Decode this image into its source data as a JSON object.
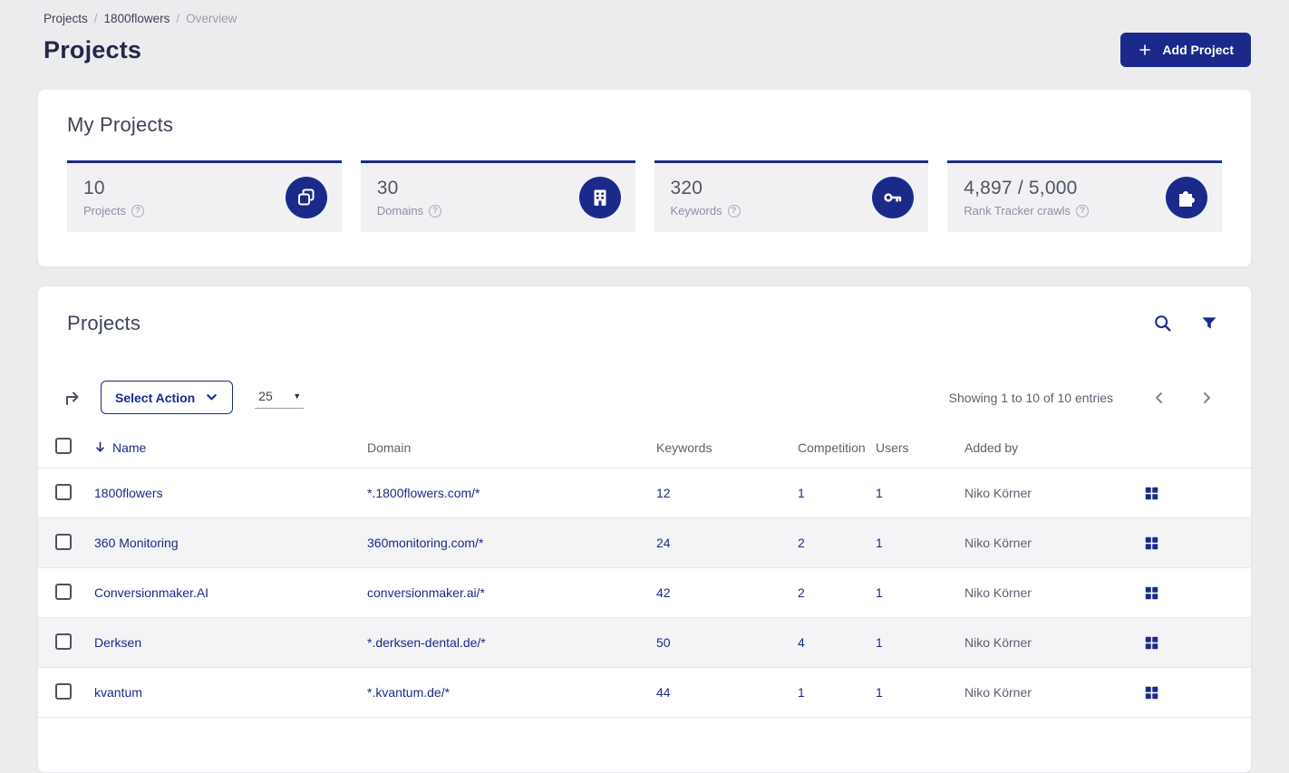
{
  "colors": {
    "primary": "#1b2a8a"
  },
  "breadcrumb": {
    "separator": "/",
    "items": [
      {
        "label": "Projects"
      },
      {
        "label": "1800flowers"
      },
      {
        "label": "Overview"
      }
    ]
  },
  "page": {
    "title": "Projects",
    "add_project_button": "Add Project"
  },
  "my_projects": {
    "title": "My Projects",
    "tiles": [
      {
        "value": "10",
        "label": "Projects",
        "icon": "copy-icon"
      },
      {
        "value": "30",
        "label": "Domains",
        "icon": "building-icon"
      },
      {
        "value": "320",
        "label": "Keywords",
        "icon": "key-icon"
      },
      {
        "value": "4,897 / 5,000",
        "label": "Rank Tracker crawls",
        "icon": "puzzle-icon"
      }
    ]
  },
  "projects_table_card": {
    "title": "Projects",
    "toolbar": {
      "select_action": "Select Action",
      "page_size": "25",
      "showing": "Showing 1 to 10 of 10 entries"
    },
    "columns": {
      "name": "Name",
      "domain": "Domain",
      "keywords": "Keywords",
      "competition": "Competition",
      "users": "Users",
      "added_by": "Added by"
    },
    "rows": [
      {
        "name": "1800flowers",
        "domain": "*.1800flowers.com/*",
        "keywords": "12",
        "competition": "1",
        "users": "1",
        "added_by": "Niko Körner"
      },
      {
        "name": "360 Monitoring",
        "domain": "360monitoring.com/*",
        "keywords": "24",
        "competition": "2",
        "users": "1",
        "added_by": "Niko Körner"
      },
      {
        "name": "Conversionmaker.AI",
        "domain": "conversionmaker.ai/*",
        "keywords": "42",
        "competition": "2",
        "users": "1",
        "added_by": "Niko Körner"
      },
      {
        "name": "Derksen",
        "domain": "*.derksen-dental.de/*",
        "keywords": "50",
        "competition": "4",
        "users": "1",
        "added_by": "Niko Körner"
      },
      {
        "name": "kvantum",
        "domain": "*.kvantum.de/*",
        "keywords": "44",
        "competition": "1",
        "users": "1",
        "added_by": "Niko Körner"
      }
    ]
  }
}
